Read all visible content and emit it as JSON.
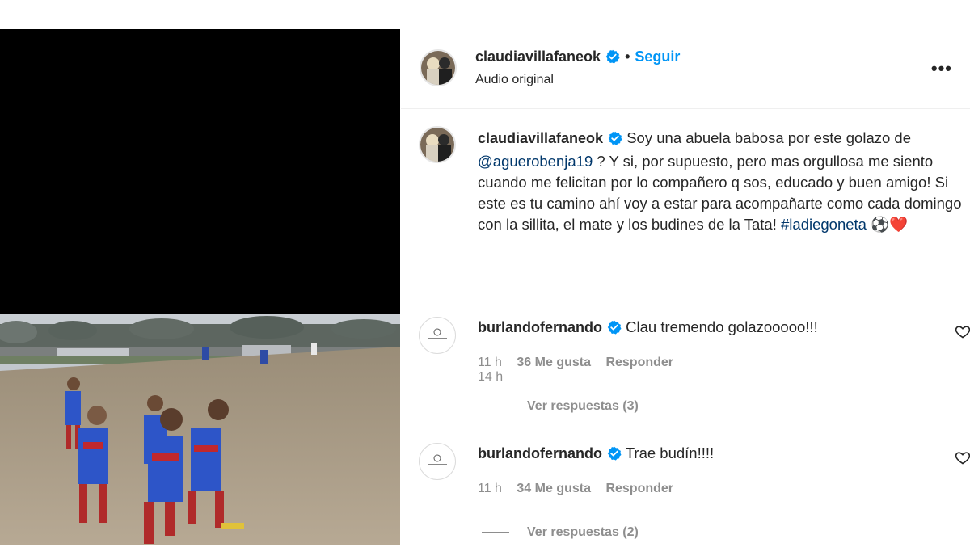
{
  "post": {
    "author": "claudiavillafaneok",
    "follow_label": "Seguir",
    "separator": "•",
    "audio_label": "Audio original",
    "more_label": "•••"
  },
  "caption": {
    "author": "claudiavillafaneok",
    "text_1": "Soy una abuela babosa por este golazo de",
    "mention": "@aguerobenja19",
    "text_2": "? Y si, por supuesto, pero mas orgullosa me siento cuando me felicitan por lo compañero q sos, educado y buen amigo! Si este es tu camino ahí voy a estar para acompañarte como cada domingo con la sillita, el mate y los budines de la Tata!",
    "hashtag": "#ladiegoneta",
    "emoji": "⚽❤️",
    "time": "14 h"
  },
  "comments": [
    {
      "author": "burlandofernando",
      "text": "Clau tremendo golazooooo!!!",
      "time": "11 h",
      "likes": "36 Me gusta",
      "reply_label": "Responder",
      "view_replies": "Ver respuestas (3)"
    },
    {
      "author": "burlandofernando",
      "text": "Trae budín!!!!",
      "time": "11 h",
      "likes": "34 Me gusta",
      "reply_label": "Responder",
      "view_replies": "Ver respuestas (2)"
    }
  ],
  "colors": {
    "link_blue": "#0095f6",
    "verified_blue": "#0095f6",
    "mention_color": "#00376b",
    "muted_text": "#8e8e8e"
  },
  "icons": [
    "verified-badge-icon",
    "more-options-icon",
    "heart-icon",
    "soccer-ball-emoji",
    "red-heart-emoji"
  ]
}
